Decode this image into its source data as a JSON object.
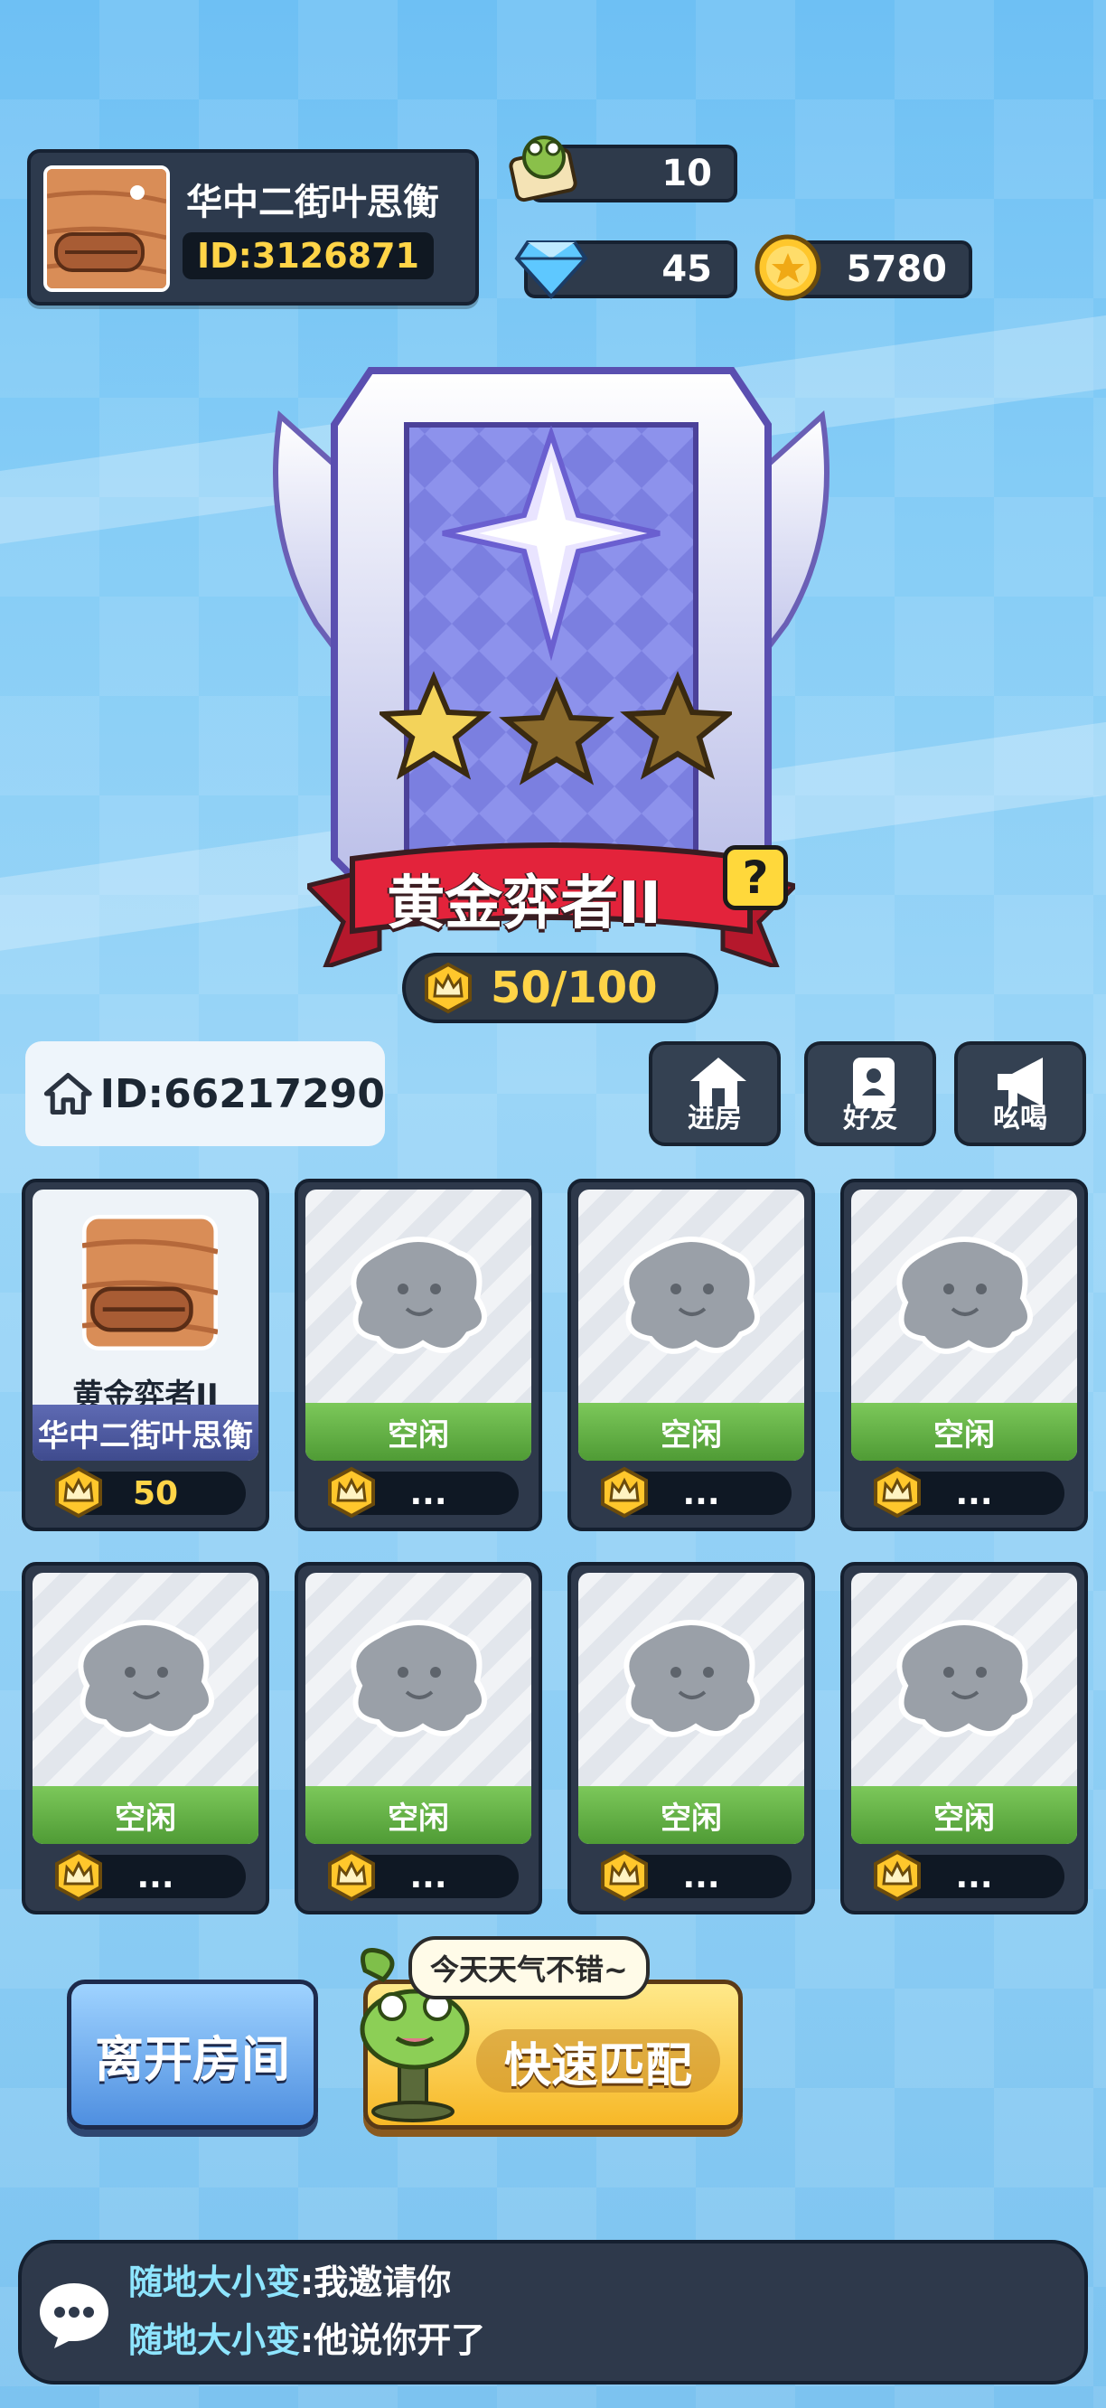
{
  "player": {
    "name": "华中二街叶思衡",
    "id": "ID:3126871"
  },
  "currencies": {
    "frog_tickets": "10",
    "diamonds": "45",
    "coins": "5780"
  },
  "rank": {
    "title": "黄金弈者II",
    "help_icon": "?",
    "stars_filled": 1,
    "stars_total": 3,
    "progress_text": "50/100"
  },
  "room": {
    "id": "ID:66217290"
  },
  "actions": [
    {
      "label": "进房"
    },
    {
      "label": "好友"
    },
    {
      "label": "吆喝"
    }
  ],
  "seats": [
    {
      "occupied": true,
      "rank": "黄金弈者II",
      "name": "华中二街叶思衡",
      "score": "50"
    },
    {
      "occupied": false,
      "status": "空闲",
      "score": "..."
    },
    {
      "occupied": false,
      "status": "空闲",
      "score": "..."
    },
    {
      "occupied": false,
      "status": "空闲",
      "score": "..."
    },
    {
      "occupied": false,
      "status": "空闲",
      "score": "..."
    },
    {
      "occupied": false,
      "status": "空闲",
      "score": "..."
    },
    {
      "occupied": false,
      "status": "空闲",
      "score": "..."
    },
    {
      "occupied": false,
      "status": "空闲",
      "score": "..."
    }
  ],
  "buttons": {
    "leave": "离开房间",
    "quick_match": "快速匹配",
    "mascot_bubble": "今天天气不错~"
  },
  "chat": [
    {
      "sender": "随地大小变",
      "message": ":我邀请你"
    },
    {
      "sender": "随地大小变",
      "message": ":他说你开了"
    }
  ],
  "colors": {
    "panel": "#2e394b",
    "gold": "#ffd447",
    "ribbon": "#e3233b",
    "idle_green": "#5eaa3f"
  }
}
